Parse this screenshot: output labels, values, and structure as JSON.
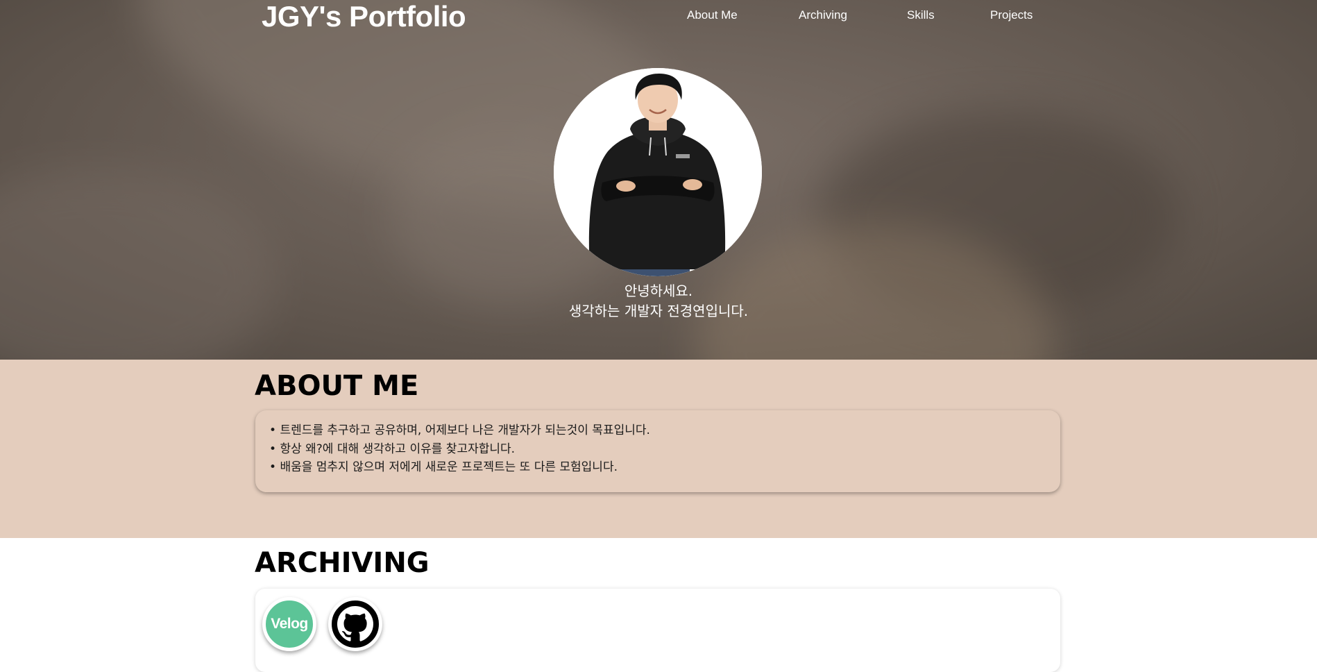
{
  "header": {
    "logo": "JGY's Portfolio",
    "nav": [
      "About Me",
      "Archiving",
      "Skills",
      "Projects"
    ]
  },
  "hero": {
    "profile_photo": "profile-photo",
    "greeting_line1": "안녕하세요.",
    "greeting_line2": "생각하는 개발자 전경연입니다."
  },
  "about": {
    "title": "ABOUT ME",
    "items": [
      "트렌드를 추구하고 공유하며, 어제보다 나은 개발자가 되는것이 목표입니다.",
      "항상 왜?에 대해 생각하고 이유를 찾고자합니다.",
      "배움을 멈추지 않으며 저에게 새로운 프로젝트는 또 다른 모험입니다."
    ]
  },
  "archiving": {
    "title": "ARCHIVING",
    "velog_label": "Velog",
    "github_icon": "github-icon"
  },
  "colors": {
    "about_bg": "#e4cdbd",
    "velog_green": "#5cc497",
    "hero_overlay": "#6d625a"
  }
}
